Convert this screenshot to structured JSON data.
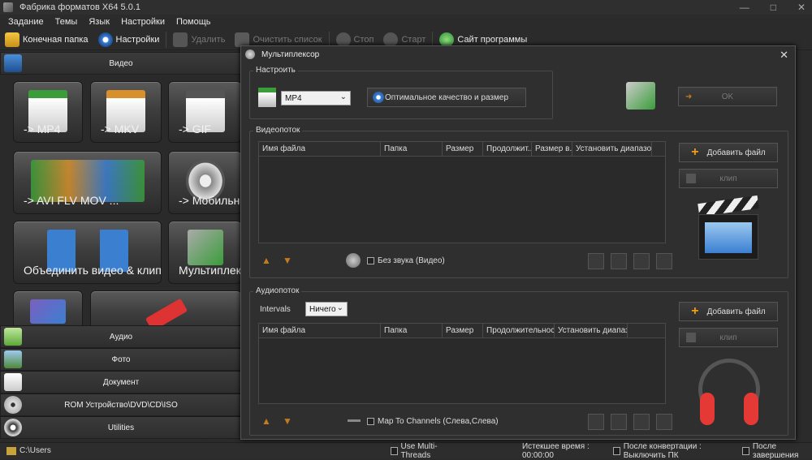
{
  "app": {
    "title": "Фабрика форматов X64 5.0.1"
  },
  "window_buttons": [
    "—",
    "□",
    "✕"
  ],
  "menu": [
    "Задание",
    "Темы",
    "Язык",
    "Настройки",
    "Помощь"
  ],
  "toolbar": {
    "output_folder": "Конечная папка",
    "settings": "Настройки",
    "delete": "Удалить",
    "clear_list": "Очистить список",
    "stop": "Стоп",
    "start": "Старт",
    "website": "Сайт программы"
  },
  "left": {
    "video_header": "Видео",
    "tiles": [
      {
        "label": "-> MP4"
      },
      {
        "label": "-> MKV"
      },
      {
        "label": "-> GIF"
      },
      {
        "label": "-> AVI FLV MOV ..."
      },
      {
        "label": "-> Мобильны"
      },
      {
        "label": "Объединить видео & клип"
      },
      {
        "label": "Мультиплек"
      }
    ],
    "categories": [
      "Аудио",
      "Фото",
      "Документ",
      "ROM Устройство\\DVD\\CD\\ISO",
      "Utilities"
    ]
  },
  "status": {
    "path": "C:\\Users",
    "multithreads": "Use Multi-Threads",
    "elapsed_label": "Истекшее время : 00:00:00",
    "after_convert": "После конвертации : Выключить ПК",
    "after_complete": "После завершения"
  },
  "dialog": {
    "title": "Мультиплексор",
    "setup_label": "Настроить",
    "format_value": "MP4",
    "quality_button": "Оптимальное качество и размер",
    "ok": "OK",
    "video": {
      "label": "Видеопоток",
      "columns": [
        "Имя файла",
        "Папка",
        "Размер",
        "Продолжит...",
        "Размер в...",
        "Установить диапазон"
      ],
      "add_file": "Добавить файл",
      "clip": "клип",
      "mute": "Без звука (Видео)"
    },
    "audio": {
      "label": "Аудиопоток",
      "intervals_label": "Intervals",
      "intervals_value": "Ничего",
      "columns": [
        "Имя файла",
        "Папка",
        "Размер",
        "Продолжительность",
        "Установить диапазон"
      ],
      "add_file": "Добавить файл",
      "clip": "клип",
      "map_channels": "Map To Channels (Слева,Слева)"
    }
  }
}
